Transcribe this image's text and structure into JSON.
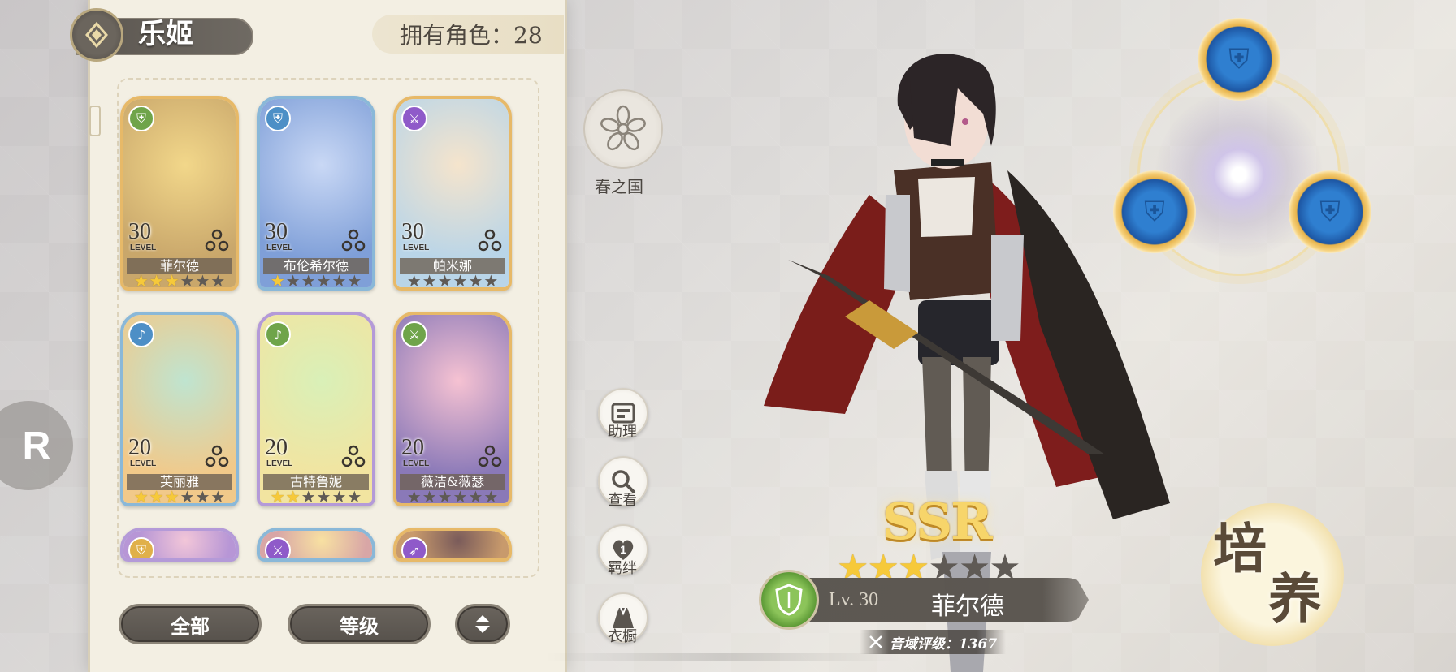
{
  "header": {
    "title": "乐姬",
    "owned": "拥有角色：28"
  },
  "region": {
    "label": "春之国"
  },
  "cards": [
    {
      "name": "菲尔德",
      "level": "30",
      "level_word": "LEVEL",
      "stars": 3,
      "frame": "gold",
      "class_icon": "shield-icon",
      "badge_color": "#6fa44a"
    },
    {
      "name": "布伦希尔德",
      "level": "30",
      "level_word": "LEVEL",
      "stars": 1,
      "frame": "blue",
      "class_icon": "shield-icon",
      "badge_color": "#4d8fc6"
    },
    {
      "name": "帕米娜",
      "level": "30",
      "level_word": "LEVEL",
      "stars": 0,
      "frame": "gold",
      "class_icon": "sword-icon",
      "badge_color": "#8f5ac9"
    },
    {
      "name": "芙丽雅",
      "level": "20",
      "level_word": "LEVEL",
      "stars": 3,
      "frame": "blue",
      "class_icon": "lyre-icon",
      "badge_color": "#4d8fc6"
    },
    {
      "name": "古特鲁妮",
      "level": "20",
      "level_word": "LEVEL",
      "stars": 2,
      "frame": "purple",
      "class_icon": "lyre-icon",
      "badge_color": "#6fa44a"
    },
    {
      "name": "薇洁&薇瑟",
      "level": "20",
      "level_word": "LEVEL",
      "stars": 0,
      "frame": "gold",
      "class_icon": "sword-icon",
      "badge_color": "#6fa44a"
    },
    {
      "name": "",
      "level": "",
      "level_word": "",
      "stars": 0,
      "frame": "purple",
      "class_icon": "shield-icon",
      "badge_color": "#e0b04a"
    },
    {
      "name": "",
      "level": "",
      "level_word": "",
      "stars": 0,
      "frame": "blue",
      "class_icon": "sword-icon",
      "badge_color": "#8f5ac9"
    },
    {
      "name": "",
      "level": "",
      "level_word": "",
      "stars": 0,
      "frame": "gold",
      "class_icon": "bow-icon",
      "badge_color": "#8f5ac9"
    }
  ],
  "filters": {
    "all_label": "全部",
    "level_label": "等级",
    "sort_icon": "sort-toggle-icon"
  },
  "side_menu": [
    {
      "label": "助理",
      "icon": "assistant-icon"
    },
    {
      "label": "查看",
      "icon": "magnifier-icon"
    },
    {
      "label": "羁绊",
      "icon": "heart-bond-icon",
      "badge": "1"
    },
    {
      "label": "衣橱",
      "icon": "wardrobe-icon"
    }
  ],
  "hero": {
    "rarity": "SSR",
    "stars_on": 3,
    "stars_total": 6,
    "level": "Lv. 30",
    "name": "菲尔德",
    "rating": "音域评级：1367",
    "class_icon": "shield-icon"
  },
  "cultivate": {
    "label_1": "培",
    "label_2": "养"
  },
  "logo": {
    "text": "R"
  },
  "colors": {
    "star_on": "#f6c93a",
    "star_off": "#5f5a55",
    "panel_bg": "#f3efe3",
    "pill_dark": "#5b5650"
  }
}
